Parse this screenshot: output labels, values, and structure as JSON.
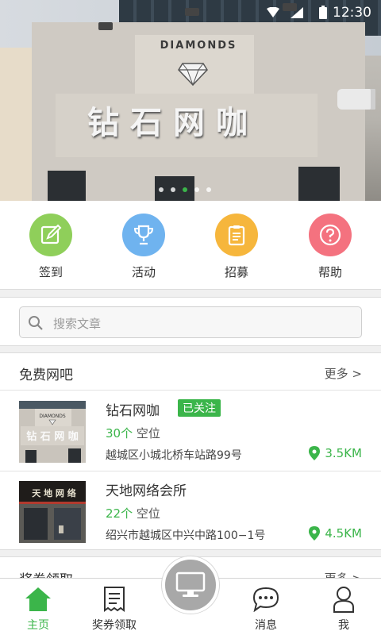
{
  "status_bar": {
    "time": "12:30"
  },
  "banner": {
    "sign_english": "DIAMONDS",
    "sign_chinese": "钻石网咖",
    "slide_count": 5,
    "active_slide": 3
  },
  "quick_actions": [
    {
      "label": "签到",
      "icon": "edit-icon",
      "color": "#8fcf5a"
    },
    {
      "label": "活动",
      "icon": "trophy-icon",
      "color": "#6fb3ef"
    },
    {
      "label": "招募",
      "icon": "clipboard-icon",
      "color": "#f6b63c"
    },
    {
      "label": "帮助",
      "icon": "help-icon",
      "color": "#f4727f"
    }
  ],
  "search": {
    "placeholder": "搜索文章"
  },
  "free_cafes": {
    "title": "免费网吧",
    "more": "更多 >",
    "items": [
      {
        "name": "钻石网咖",
        "badge": "已关注",
        "seats_count": "30个",
        "seats_label": "空位",
        "address": "越城区小城北桥车站路99号",
        "distance": "3.5KM"
      },
      {
        "name": "天地网络会所",
        "seats_count": "22个",
        "seats_label": "空位",
        "address": "绍兴市越城区中兴中路100−1号",
        "distance": "4.5KM"
      }
    ]
  },
  "rewards_section": {
    "title": "奖券领取",
    "more": "更多 >"
  },
  "bottom_nav": [
    {
      "label": "主页",
      "icon": "home-icon",
      "active": true
    },
    {
      "label": "奖券领取",
      "icon": "receipt-icon",
      "active": false
    },
    {
      "label": "",
      "icon": "monitor-icon",
      "active": false
    },
    {
      "label": "消息",
      "icon": "chat-icon",
      "active": false
    },
    {
      "label": "我",
      "icon": "user-icon",
      "active": false
    }
  ],
  "colors": {
    "accent": "#3bb54a"
  }
}
